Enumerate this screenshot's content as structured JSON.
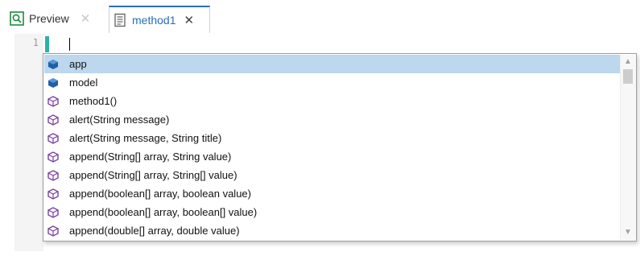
{
  "tabs": [
    {
      "label": "Preview",
      "icon": "preview-icon",
      "close": "✕"
    },
    {
      "label": "method1",
      "icon": "method-file-icon",
      "close": "✕"
    }
  ],
  "editor": {
    "line_numbers": [
      "1"
    ]
  },
  "completion": {
    "selected_index": 0,
    "items": [
      {
        "label": "app",
        "kind": "field-icon"
      },
      {
        "label": "model",
        "kind": "field-icon"
      },
      {
        "label": "method1()",
        "kind": "method-icon"
      },
      {
        "label": "alert(String message)",
        "kind": "method-icon"
      },
      {
        "label": "alert(String message, String title)",
        "kind": "method-icon"
      },
      {
        "label": "append(String[] array, String value)",
        "kind": "method-icon"
      },
      {
        "label": "append(String[] array, String[] value)",
        "kind": "method-icon"
      },
      {
        "label": "append(boolean[] array, boolean value)",
        "kind": "method-icon"
      },
      {
        "label": "append(boolean[] array, boolean[] value)",
        "kind": "method-icon"
      },
      {
        "label": "append(double[] array, double value)",
        "kind": "method-icon"
      }
    ]
  },
  "colors": {
    "accent": "#2a6fb5",
    "selection": "#bcd7ee",
    "change_marker": "#2bb3a6",
    "field_icon": "#1f5fa8",
    "method_icon": "#7a3fa3"
  }
}
